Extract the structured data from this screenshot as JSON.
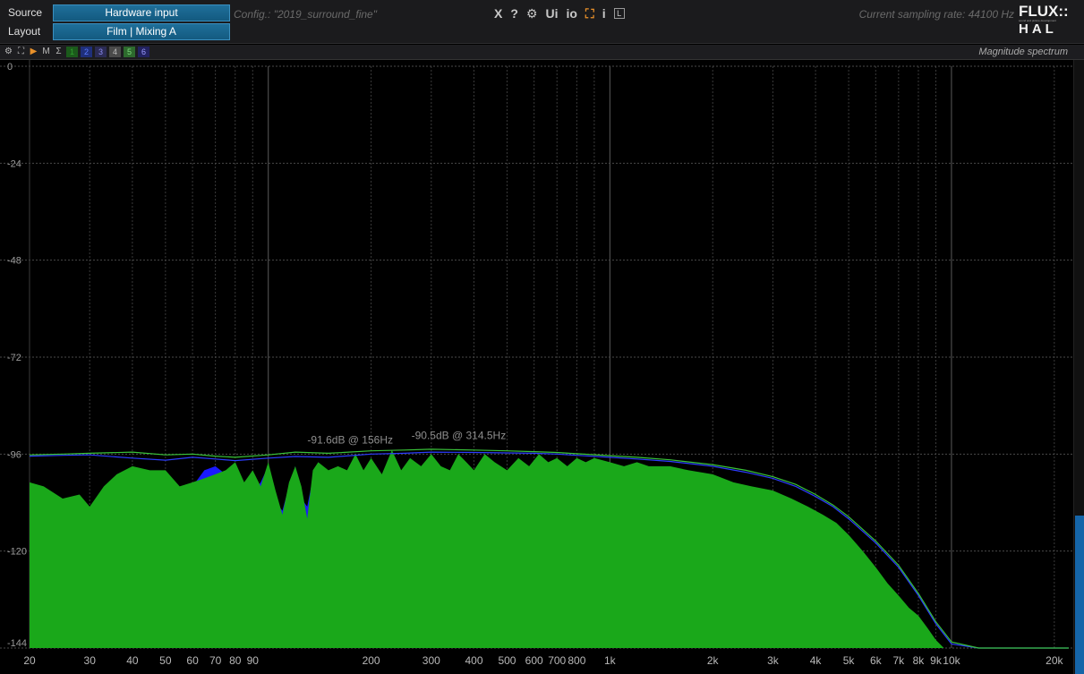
{
  "topbar": {
    "source_label": "Source",
    "source_value": "Hardware input",
    "layout_label": "Layout",
    "layout_value": "Film | Mixing A",
    "config": "Config.: \"2019_surround_fine\"",
    "sampling_rate": "Current sampling rate: 44100 Hz",
    "icons": [
      {
        "name": "close-icon",
        "glyph": "X"
      },
      {
        "name": "help-icon",
        "glyph": "?"
      },
      {
        "name": "settings-icon",
        "glyph": "⚙"
      },
      {
        "name": "ui-icon",
        "glyph": "Ui"
      },
      {
        "name": "io-icon",
        "glyph": "io"
      },
      {
        "name": "fullscreen-icon",
        "glyph": "⛶"
      },
      {
        "name": "info-icon",
        "glyph": "i"
      },
      {
        "name": "license-icon",
        "glyph": "L"
      }
    ],
    "logo_top": "FLUX::",
    "logo_sub": "sound and picture development",
    "logo_bottom": "HAL"
  },
  "analyzer": {
    "title": "Magnitude spectrum",
    "tools": [
      {
        "name": "settings-icon",
        "glyph": "⚙"
      },
      {
        "name": "expand-icon",
        "glyph": "⛶"
      },
      {
        "name": "play-icon",
        "glyph": "▶"
      },
      {
        "name": "mute-icon",
        "glyph": "M"
      },
      {
        "name": "sum-icon",
        "glyph": "Σ"
      }
    ],
    "channels": [
      {
        "label": "1",
        "color": "#2e9d2e",
        "bg": "#1b5a1b"
      },
      {
        "label": "2",
        "color": "#5c7cff",
        "bg": "#1f2f7a"
      },
      {
        "label": "3",
        "color": "#8c8cf0",
        "bg": "#2b2b55"
      },
      {
        "label": "4",
        "color": "#bdbdbd",
        "bg": "#4a4a4a"
      },
      {
        "label": "5",
        "color": "#7fd87f",
        "bg": "#2d6a2d"
      },
      {
        "label": "6",
        "color": "#9d9dff",
        "bg": "#222260"
      }
    ]
  },
  "chart_data": {
    "type": "area",
    "title": "Magnitude spectrum",
    "xscale": "log",
    "xlim": [
      20,
      22050
    ],
    "ylim": [
      -144,
      0
    ],
    "grid": true,
    "y_ticks": [
      0,
      -24,
      -48,
      -72,
      -96,
      -120,
      -144
    ],
    "x_ticks": [
      {
        "v": 20,
        "label": "20"
      },
      {
        "v": 30,
        "label": "30"
      },
      {
        "v": 40,
        "label": "40"
      },
      {
        "v": 50,
        "label": "50"
      },
      {
        "v": 60,
        "label": "60"
      },
      {
        "v": 70,
        "label": "70"
      },
      {
        "v": 80,
        "label": "80"
      },
      {
        "v": 90,
        "label": "90"
      },
      {
        "v": 200,
        "label": "200"
      },
      {
        "v": 300,
        "label": "300"
      },
      {
        "v": 400,
        "label": "400"
      },
      {
        "v": 500,
        "label": "500"
      },
      {
        "v": 600,
        "label": "600"
      },
      {
        "v": 700,
        "label": "700"
      },
      {
        "v": 800,
        "label": "800"
      },
      {
        "v": 1000,
        "label": "1k"
      },
      {
        "v": 2000,
        "label": "2k"
      },
      {
        "v": 3000,
        "label": "3k"
      },
      {
        "v": 4000,
        "label": "4k"
      },
      {
        "v": 5000,
        "label": "5k"
      },
      {
        "v": 6000,
        "label": "6k"
      },
      {
        "v": 7000,
        "label": "7k"
      },
      {
        "v": 8000,
        "label": "8k"
      },
      {
        "v": 9000,
        "label": "9k"
      },
      {
        "v": 10000,
        "label": "10k"
      },
      {
        "v": 20000,
        "label": "20k"
      }
    ],
    "markers": [
      {
        "text": "-91.6dB @ 156Hz",
        "x": 156,
        "y": -91.6
      },
      {
        "text": "-90.5dB @ 314.5Hz",
        "x": 314.5,
        "y": -90.5
      }
    ],
    "series": [
      {
        "color": "#1a1aff",
        "style": "filled",
        "x": [
          20,
          22,
          25,
          28,
          30,
          33,
          36,
          40,
          45,
          50,
          55,
          60,
          65,
          70,
          75,
          80,
          85,
          90,
          95,
          100,
          105,
          110,
          115,
          120,
          125,
          130,
          135,
          140,
          150,
          160,
          170,
          180,
          190,
          200,
          215,
          230,
          245,
          260,
          280,
          300,
          320,
          340,
          360,
          380,
          400,
          430,
          460,
          500,
          540,
          580,
          620,
          660,
          700,
          750,
          800,
          850,
          900,
          1000,
          1100,
          1200,
          1300,
          1500,
          1700,
          2000,
          2300,
          2600,
          3000,
          3400,
          3800,
          4200,
          4600,
          5000,
          5500,
          6000,
          6500,
          7000,
          7500,
          8000,
          8500,
          9000,
          9500,
          10000,
          12000,
          15000,
          18000,
          20000,
          22050
        ],
        "y": [
          -105,
          -110,
          -107,
          -108,
          -112,
          -107,
          -103,
          -102,
          -104,
          -100,
          -106,
          -104,
          -100,
          -99,
          -101,
          -105,
          -103,
          -106,
          -103,
          -99,
          -108,
          -110,
          -104,
          -99,
          -107,
          -109,
          -102,
          -98,
          -103,
          -99,
          -102,
          -96,
          -101,
          -98,
          -103,
          -97,
          -102,
          -98,
          -101,
          -97,
          -100,
          -102,
          -97,
          -99,
          -101,
          -97,
          -99,
          -102,
          -98,
          -100,
          -97,
          -99,
          -98,
          -100,
          -98,
          -99,
          -98,
          -99,
          -100,
          -99,
          -100,
          -100,
          -101,
          -102,
          -104,
          -105,
          -106,
          -108,
          -110,
          -112,
          -114,
          -117,
          -121,
          -125,
          -129,
          -132,
          -135,
          -137,
          -140,
          -143,
          -144,
          -144,
          -144,
          -144,
          -144,
          -144,
          -144
        ]
      },
      {
        "color": "#1aa81a",
        "style": "filled",
        "x": [
          20,
          22,
          25,
          28,
          30,
          33,
          36,
          40,
          45,
          50,
          55,
          60,
          65,
          70,
          75,
          80,
          85,
          90,
          95,
          100,
          105,
          110,
          115,
          120,
          125,
          130,
          135,
          140,
          150,
          160,
          170,
          180,
          190,
          200,
          215,
          230,
          245,
          260,
          280,
          300,
          320,
          340,
          360,
          380,
          400,
          430,
          460,
          500,
          540,
          580,
          620,
          660,
          700,
          750,
          800,
          850,
          900,
          1000,
          1100,
          1200,
          1300,
          1500,
          1700,
          2000,
          2300,
          2600,
          3000,
          3400,
          3800,
          4200,
          4600,
          5000,
          5500,
          6000,
          6500,
          7000,
          7500,
          8000,
          8500,
          9000,
          9500,
          10000,
          12000,
          15000,
          18000,
          20000,
          22050
        ],
        "y": [
          -103,
          -104,
          -107,
          -106,
          -109,
          -104,
          -101,
          -99,
          -100,
          -100,
          -104,
          -103,
          -102,
          -101,
          -100,
          -98,
          -103,
          -100,
          -104,
          -98,
          -105,
          -111,
          -103,
          -99,
          -104,
          -112,
          -100,
          -98,
          -100,
          -99,
          -100,
          -96,
          -100,
          -97,
          -101,
          -95,
          -100,
          -97,
          -99,
          -96,
          -99,
          -100,
          -96,
          -98,
          -100,
          -96,
          -98,
          -100,
          -97,
          -99,
          -96,
          -98,
          -97,
          -99,
          -97,
          -98,
          -97,
          -98,
          -99,
          -98,
          -99,
          -99,
          -100,
          -101,
          -103,
          -104,
          -105,
          -107,
          -109,
          -111,
          -113,
          -116,
          -120,
          -124,
          -128,
          -131,
          -134,
          -136,
          -139,
          -142,
          -144,
          -144,
          -144,
          -144,
          -144,
          -144,
          -144
        ]
      },
      {
        "color": "#2c3cff",
        "style": "line",
        "x": [
          20,
          25,
          30,
          40,
          50,
          60,
          70,
          80,
          100,
          120,
          150,
          200,
          250,
          300,
          400,
          500,
          600,
          700,
          800,
          1000,
          1200,
          1500,
          2000,
          2500,
          3000,
          3500,
          4000,
          4500,
          5000,
          6000,
          7000,
          8000,
          9000,
          10000,
          12000,
          15000,
          20000,
          22050
        ],
        "y": [
          -96.5,
          -96.3,
          -96.2,
          -97,
          -97.5,
          -96.8,
          -97.2,
          -97.6,
          -97,
          -96.6,
          -96.8,
          -96,
          -95.8,
          -95.5,
          -95.6,
          -95.7,
          -95.8,
          -96,
          -96.3,
          -96.8,
          -97.2,
          -97.8,
          -99,
          -100.5,
          -102,
          -104,
          -106.5,
          -109,
          -112,
          -118,
          -124,
          -131,
          -138,
          -143,
          -144,
          -144,
          -144,
          -144
        ]
      },
      {
        "color": "#39c239",
        "style": "line",
        "x": [
          20,
          25,
          30,
          40,
          50,
          60,
          70,
          80,
          100,
          120,
          150,
          200,
          250,
          300,
          400,
          500,
          600,
          700,
          800,
          1000,
          1200,
          1500,
          2000,
          2500,
          3000,
          3500,
          4000,
          4500,
          5000,
          6000,
          7000,
          8000,
          9000,
          10000,
          12000,
          15000,
          20000,
          22050
        ],
        "y": [
          -96.2,
          -96,
          -95.8,
          -95.5,
          -96.2,
          -96,
          -96.5,
          -96.8,
          -96.2,
          -95.5,
          -95.8,
          -95.2,
          -95,
          -94.8,
          -95,
          -95.2,
          -95.4,
          -95.6,
          -95.9,
          -96.4,
          -96.8,
          -97.4,
          -98.6,
          -100,
          -101.6,
          -103.5,
          -106,
          -108.6,
          -111.5,
          -117.5,
          -123.5,
          -130.5,
          -137.5,
          -142.5,
          -144,
          -144,
          -144,
          -144
        ]
      }
    ]
  }
}
